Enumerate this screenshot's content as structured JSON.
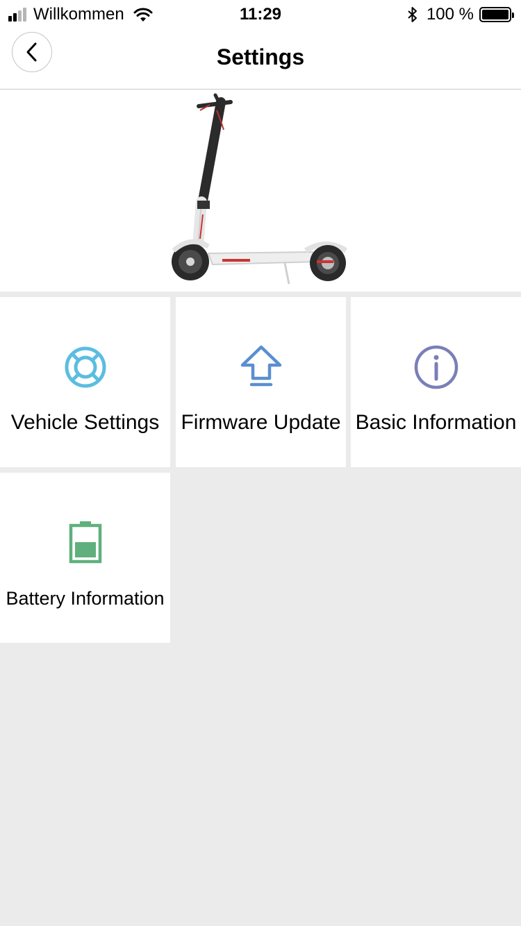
{
  "status_bar": {
    "carrier": "Willkommen",
    "time": "11:29",
    "battery_percent": "100 %",
    "signal_bars_filled": 2,
    "signal_bars_total": 4
  },
  "nav": {
    "title": "Settings",
    "back_icon": "chevron-left-icon"
  },
  "hero": {
    "image": "electric-scooter-image"
  },
  "tiles": [
    {
      "label": "Vehicle Settings",
      "icon": "lifebuoy-icon",
      "color": "#5bbde1"
    },
    {
      "label": "Firmware Update",
      "icon": "upload-arrow-icon",
      "color": "#5a8fd0"
    },
    {
      "label": "Basic Information",
      "icon": "info-circle-icon",
      "color": "#7a7fb8"
    },
    {
      "label": "Battery Information",
      "icon": "battery-icon",
      "color": "#5fb07d"
    }
  ],
  "colors": {
    "background": "#ebebeb",
    "tile_background": "#ffffff"
  }
}
